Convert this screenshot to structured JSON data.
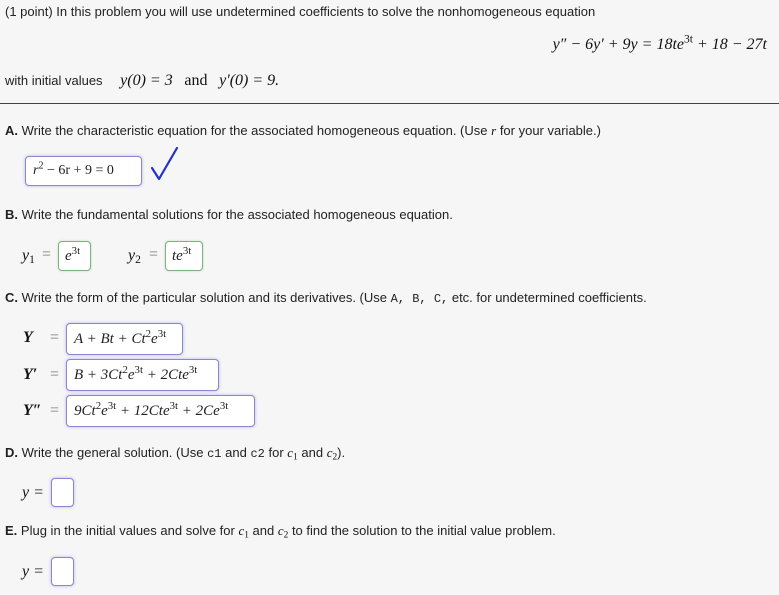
{
  "intro": {
    "text": "(1 point) In this problem you will use undetermined coefficients to solve the nonhomogeneous equation",
    "equation": {
      "lhs": "y″ − 6y′ + 9y =",
      "rhs_a": "18te",
      "rhs_a_exp": "3t",
      "rhs_b": "+ 18 − 27t"
    },
    "initial_label": "with initial values",
    "initial_1": "y(0) = 3",
    "initial_and": "and",
    "initial_2": "y′(0) = 9."
  },
  "partA": {
    "letter": "A.",
    "text": "Write the characteristic equation for the associated homogeneous equation. (Use",
    "var": "r",
    "text_end": "for your variable.)",
    "answer_base": "r",
    "answer_exp": "2",
    "answer_rest": "− 6r + 9 = 0",
    "status": "correct",
    "check_color": "#2233cc"
  },
  "partB": {
    "letter": "B.",
    "text": "Write the fundamental solutions for the associated homogeneous equation.",
    "y1_label": "y",
    "y1_sub": "1",
    "y1_base": "e",
    "y1_exp": "3t",
    "y2_label": "y",
    "y2_sub": "2",
    "y2_base": "te",
    "y2_exp": "3t",
    "eq_sign": "="
  },
  "partC": {
    "letter": "C.",
    "text_a": "Write the form of the particular solution and its derivatives. (Use",
    "codes": "A, B, C,",
    "text_b": "etc. for undetermined coefficients.",
    "rows": [
      {
        "label": "Y",
        "parts": [
          "A + Bt + Ct",
          "2",
          "e",
          "3t"
        ]
      },
      {
        "label": "Y′",
        "parts": [
          "B + 3Ct",
          "2",
          "e",
          "3t",
          " + 2Cte",
          "3t"
        ]
      },
      {
        "label": "Y″",
        "parts": [
          "9Ct",
          "2",
          "e",
          "3t",
          " + 12Cte",
          "3t",
          " + 2Ce",
          "3t"
        ]
      }
    ]
  },
  "partD": {
    "letter": "D.",
    "text_a": "Write the general solution. (Use",
    "code1": "c1",
    "and": "and",
    "code2": "c2",
    "for": "for",
    "c": "c",
    "s1": "1",
    "s2": "2",
    "end": ").",
    "label": "y =",
    "value": ""
  },
  "partE": {
    "letter": "E.",
    "text_a": "Plug in the initial values and solve for",
    "c": "c",
    "s1": "1",
    "and": "and",
    "s2": "2",
    "text_b": "to find the solution to the initial value problem.",
    "label": "y =",
    "value": ""
  }
}
